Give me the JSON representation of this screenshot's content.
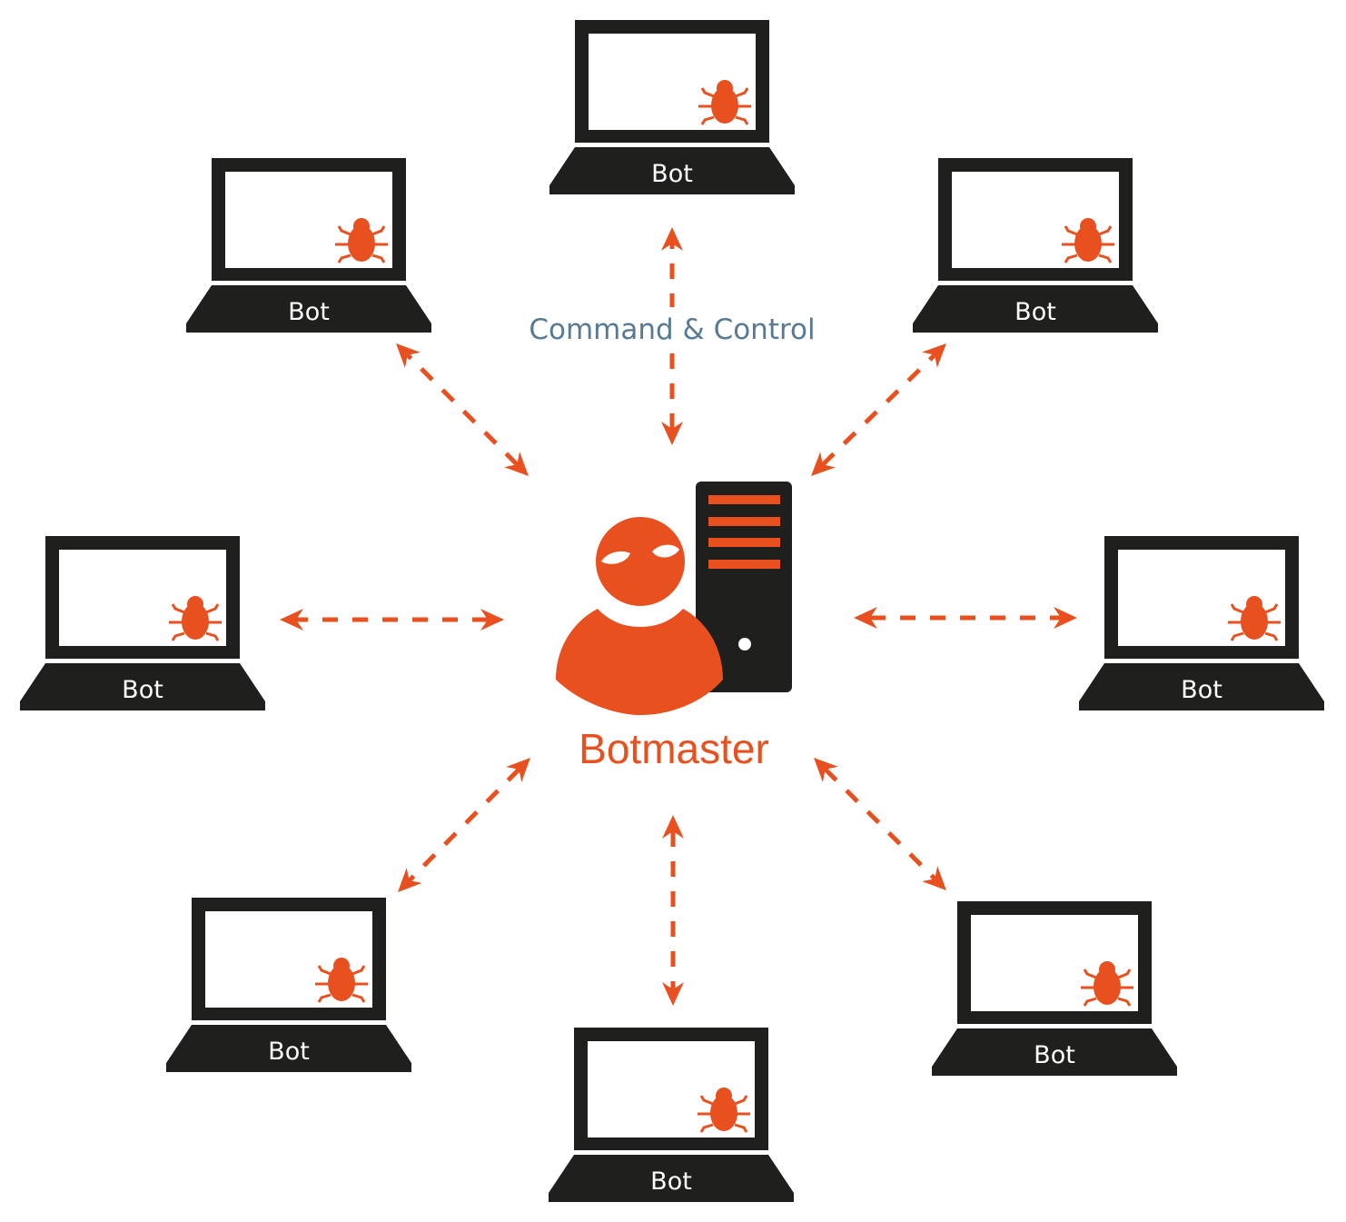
{
  "colors": {
    "accent": "#e8501f",
    "dark": "#1f1f1d",
    "label_blue": "#587a94",
    "background": "#ffffff"
  },
  "center": {
    "label": "Botmaster",
    "person_icon": "hacker-person-icon",
    "server_icon": "server-tower-icon"
  },
  "channel_label": "Command & Control",
  "bots": [
    {
      "id": "top",
      "label": "Bot",
      "icon": "bug-icon"
    },
    {
      "id": "top-left",
      "label": "Bot",
      "icon": "bug-icon"
    },
    {
      "id": "top-right",
      "label": "Bot",
      "icon": "bug-icon"
    },
    {
      "id": "left",
      "label": "Bot",
      "icon": "bug-icon"
    },
    {
      "id": "right",
      "label": "Bot",
      "icon": "bug-icon"
    },
    {
      "id": "bottom-left",
      "label": "Bot",
      "icon": "bug-icon"
    },
    {
      "id": "bottom-right",
      "label": "Bot",
      "icon": "bug-icon"
    },
    {
      "id": "bottom",
      "label": "Bot",
      "icon": "bug-icon"
    }
  ],
  "connections": [
    {
      "from": "botmaster",
      "to": "top",
      "style": "dashed-bidirectional"
    },
    {
      "from": "botmaster",
      "to": "top-left",
      "style": "dashed-bidirectional"
    },
    {
      "from": "botmaster",
      "to": "top-right",
      "style": "dashed-bidirectional"
    },
    {
      "from": "botmaster",
      "to": "left",
      "style": "dashed-bidirectional"
    },
    {
      "from": "botmaster",
      "to": "right",
      "style": "dashed-bidirectional"
    },
    {
      "from": "botmaster",
      "to": "bottom-left",
      "style": "dashed-bidirectional"
    },
    {
      "from": "botmaster",
      "to": "bottom-right",
      "style": "dashed-bidirectional"
    },
    {
      "from": "botmaster",
      "to": "bottom",
      "style": "dashed-bidirectional"
    }
  ]
}
